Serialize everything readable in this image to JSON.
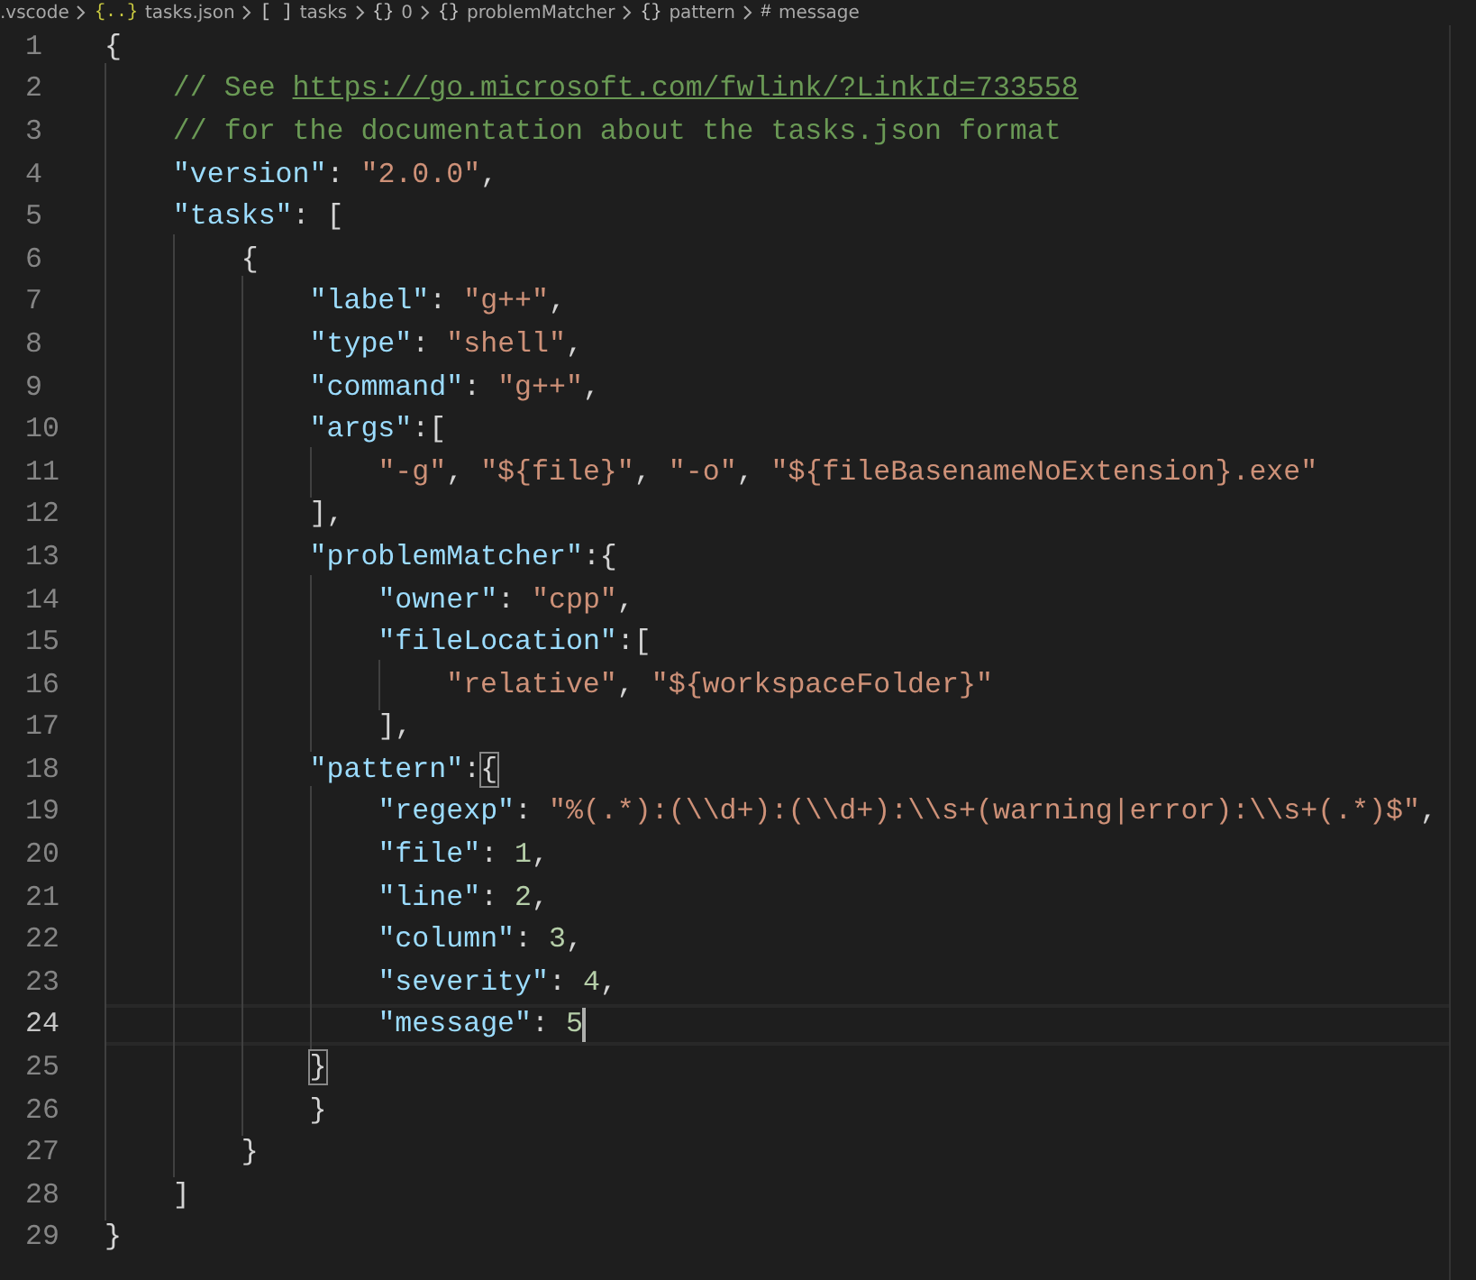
{
  "breadcrumb": [
    {
      "label": ".vscode"
    },
    {
      "icon": "{..}",
      "label": "tasks.json"
    },
    {
      "icon": "[ ]",
      "label": "tasks"
    },
    {
      "icon": "{}",
      "label": "0"
    },
    {
      "icon": "{}",
      "label": "problemMatcher"
    },
    {
      "icon": "{}",
      "label": "pattern"
    },
    {
      "icon": "#",
      "label": "message"
    }
  ],
  "lines": [
    {
      "number": "1",
      "current": false,
      "tokens": [
        {
          "kind": "punct",
          "text": "{"
        }
      ],
      "children": [
        {
          "number": "2",
          "current": false,
          "tokens": [
            {
              "kind": "comment",
              "text": "// See "
            },
            {
              "kind": "link",
              "text": "https://go.microsoft.com/fwlink/?LinkId=733558"
            }
          ]
        },
        {
          "number": "3",
          "current": false,
          "tokens": [
            {
              "kind": "comment",
              "text": "// for the documentation about the tasks.json format"
            }
          ]
        },
        {
          "number": "4",
          "current": false,
          "tokens": [
            {
              "kind": "key",
              "text": "\"version\""
            },
            {
              "kind": "punct",
              "text": ": "
            },
            {
              "kind": "string",
              "text": "\"2.0.0\""
            },
            {
              "kind": "punct",
              "text": ","
            }
          ]
        },
        {
          "number": "5",
          "current": false,
          "tokens": [
            {
              "kind": "key",
              "text": "\"tasks\""
            },
            {
              "kind": "punct",
              "text": ": ["
            }
          ],
          "children": [
            {
              "number": "6",
              "current": false,
              "tokens": [
                {
                  "kind": "punct",
                  "text": "{"
                }
              ],
              "children": [
                {
                  "number": "7",
                  "current": false,
                  "tokens": [
                    {
                      "kind": "key",
                      "text": "\"label\""
                    },
                    {
                      "kind": "punct",
                      "text": ": "
                    },
                    {
                      "kind": "string",
                      "text": "\"g++\""
                    },
                    {
                      "kind": "punct",
                      "text": ","
                    }
                  ]
                },
                {
                  "number": "8",
                  "current": false,
                  "tokens": [
                    {
                      "kind": "key",
                      "text": "\"type\""
                    },
                    {
                      "kind": "punct",
                      "text": ": "
                    },
                    {
                      "kind": "string",
                      "text": "\"shell\""
                    },
                    {
                      "kind": "punct",
                      "text": ","
                    }
                  ]
                },
                {
                  "number": "9",
                  "current": false,
                  "tokens": [
                    {
                      "kind": "key",
                      "text": "\"command\""
                    },
                    {
                      "kind": "punct",
                      "text": ": "
                    },
                    {
                      "kind": "string",
                      "text": "\"g++\""
                    },
                    {
                      "kind": "punct",
                      "text": ","
                    }
                  ]
                },
                {
                  "number": "10",
                  "current": false,
                  "tokens": [
                    {
                      "kind": "key",
                      "text": "\"args\""
                    },
                    {
                      "kind": "punct",
                      "text": ":["
                    }
                  ],
                  "children": [
                    {
                      "number": "11",
                      "current": false,
                      "tokens": [
                        {
                          "kind": "string",
                          "text": "\"-g\""
                        },
                        {
                          "kind": "punct",
                          "text": ", "
                        },
                        {
                          "kind": "string",
                          "text": "\"${file}\""
                        },
                        {
                          "kind": "punct",
                          "text": ", "
                        },
                        {
                          "kind": "string",
                          "text": "\"-o\""
                        },
                        {
                          "kind": "punct",
                          "text": ", "
                        },
                        {
                          "kind": "string",
                          "text": "\"${fileBasenameNoExtension}.exe\""
                        }
                      ]
                    }
                  ]
                },
                {
                  "number": "12",
                  "current": false,
                  "tokens": [
                    {
                      "kind": "punct",
                      "text": "],"
                    }
                  ]
                },
                {
                  "number": "13",
                  "current": false,
                  "tokens": [
                    {
                      "kind": "key",
                      "text": "\"problemMatcher\""
                    },
                    {
                      "kind": "punct",
                      "text": ":{"
                    }
                  ],
                  "children": [
                    {
                      "number": "14",
                      "current": false,
                      "tokens": [
                        {
                          "kind": "key",
                          "text": "\"owner\""
                        },
                        {
                          "kind": "punct",
                          "text": ": "
                        },
                        {
                          "kind": "string",
                          "text": "\"cpp\""
                        },
                        {
                          "kind": "punct",
                          "text": ","
                        }
                      ]
                    },
                    {
                      "number": "15",
                      "current": false,
                      "tokens": [
                        {
                          "kind": "key",
                          "text": "\"fileLocation\""
                        },
                        {
                          "kind": "punct",
                          "text": ":["
                        }
                      ],
                      "children": [
                        {
                          "number": "16",
                          "current": false,
                          "tokens": [
                            {
                              "kind": "string",
                              "text": "\"relative\""
                            },
                            {
                              "kind": "punct",
                              "text": ", "
                            },
                            {
                              "kind": "string",
                              "text": "\"${workspaceFolder}\""
                            }
                          ]
                        }
                      ]
                    },
                    {
                      "number": "17",
                      "current": false,
                      "tokens": [
                        {
                          "kind": "punct",
                          "text": "],"
                        }
                      ]
                    }
                  ]
                },
                {
                  "number": "18",
                  "current": false,
                  "tokens": [
                    {
                      "kind": "key",
                      "text": "\"pattern\""
                    },
                    {
                      "kind": "punct",
                      "text": ":"
                    },
                    {
                      "kind": "match",
                      "text": "{"
                    }
                  ],
                  "children": [
                    {
                      "number": "19",
                      "current": false,
                      "tokens": [
                        {
                          "kind": "key",
                          "text": "\"regexp\""
                        },
                        {
                          "kind": "punct",
                          "text": ": "
                        },
                        {
                          "kind": "string",
                          "text": "\"%(.*):(\\\\d+):(\\\\d+):\\\\s+(warning|error):\\\\s+(.*)$\""
                        },
                        {
                          "kind": "punct",
                          "text": ","
                        }
                      ]
                    },
                    {
                      "number": "20",
                      "current": false,
                      "tokens": [
                        {
                          "kind": "key",
                          "text": "\"file\""
                        },
                        {
                          "kind": "punct",
                          "text": ": "
                        },
                        {
                          "kind": "number",
                          "text": "1"
                        },
                        {
                          "kind": "punct",
                          "text": ","
                        }
                      ]
                    },
                    {
                      "number": "21",
                      "current": false,
                      "tokens": [
                        {
                          "kind": "key",
                          "text": "\"line\""
                        },
                        {
                          "kind": "punct",
                          "text": ": "
                        },
                        {
                          "kind": "number",
                          "text": "2"
                        },
                        {
                          "kind": "punct",
                          "text": ","
                        }
                      ]
                    },
                    {
                      "number": "22",
                      "current": false,
                      "tokens": [
                        {
                          "kind": "key",
                          "text": "\"column\""
                        },
                        {
                          "kind": "punct",
                          "text": ": "
                        },
                        {
                          "kind": "number",
                          "text": "3"
                        },
                        {
                          "kind": "punct",
                          "text": ","
                        }
                      ]
                    },
                    {
                      "number": "23",
                      "current": false,
                      "tokens": [
                        {
                          "kind": "key",
                          "text": "\"severity\""
                        },
                        {
                          "kind": "punct",
                          "text": ": "
                        },
                        {
                          "kind": "number",
                          "text": "4"
                        },
                        {
                          "kind": "punct",
                          "text": ","
                        }
                      ]
                    },
                    {
                      "number": "24",
                      "current": true,
                      "tokens": [
                        {
                          "kind": "key",
                          "text": "\"message\""
                        },
                        {
                          "kind": "punct",
                          "text": ": "
                        },
                        {
                          "kind": "number",
                          "text": "5"
                        }
                      ]
                    }
                  ]
                },
                {
                  "number": "25",
                  "current": false,
                  "tokens": [
                    {
                      "kind": "match",
                      "text": "}"
                    }
                  ]
                },
                {
                  "number": "26",
                  "current": false,
                  "tokens": [
                    {
                      "kind": "punct",
                      "text": "}"
                    }
                  ]
                }
              ]
            },
            {
              "number": "27",
              "current": false,
              "tokens": [
                {
                  "kind": "punct",
                  "text": "}"
                }
              ]
            }
          ]
        },
        {
          "number": "28",
          "current": false,
          "tokens": [
            {
              "kind": "punct",
              "text": "]"
            }
          ]
        }
      ]
    },
    {
      "number": "29",
      "current": false,
      "tokens": [
        {
          "kind": "punct",
          "text": "}"
        }
      ]
    }
  ]
}
